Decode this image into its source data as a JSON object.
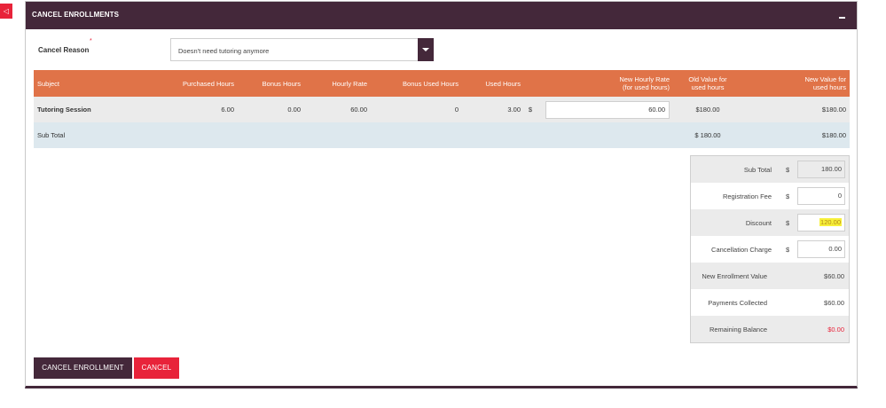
{
  "side_tab": {
    "icon": "◁"
  },
  "panel": {
    "title": "CANCEL ENROLLMENTS",
    "collapse_icon": "minus-icon"
  },
  "cancel_reason": {
    "label": "Cancel Reason",
    "required_mark": "*",
    "selected": "Doesn't need tutoring anymore"
  },
  "table": {
    "headers": {
      "subject": "Subject",
      "purchased_hours": "Purchased Hours",
      "bonus_hours": "Bonus Hours",
      "hourly_rate": "Hourly Rate",
      "bonus_used_hours": "Bonus Used Hours",
      "used_hours": "Used Hours",
      "new_hourly_rate_line1": "New Hourly Rate",
      "new_hourly_rate_line2": "(for used hours)",
      "old_value_line1": "Old Value for",
      "old_value_line2": "used hours",
      "new_value_line1": "New Value for",
      "new_value_line2": "used hours"
    },
    "row": {
      "subject": "Tutoring Session",
      "purchased_hours": "6.00",
      "bonus_hours": "0.00",
      "hourly_rate": "60.00",
      "bonus_used_hours": "0",
      "used_hours": "3.00",
      "currency": "$",
      "new_hourly_rate": "60.00",
      "old_value": "$180.00",
      "new_value": "$180.00"
    },
    "subtotal": {
      "label": "Sub Total",
      "old_value": "$  180.00",
      "new_value": "$180.00"
    }
  },
  "summary": {
    "sub_total": {
      "label": "Sub Total",
      "currency": "$",
      "value": "180.00"
    },
    "registration_fee": {
      "label": "Registration Fee",
      "currency": "$",
      "value": "0"
    },
    "discount": {
      "label": "Discount",
      "currency": "$",
      "value": "120.00"
    },
    "cancellation_charge": {
      "label": "Cancellation Charge",
      "currency": "$",
      "value": "0.00"
    },
    "new_enrollment_value": {
      "label": "New Enrollment Value",
      "value": "$60.00"
    },
    "payments_collected": {
      "label": "Payments Collected",
      "value": "$60.00"
    },
    "remaining_balance": {
      "label": "Remaining Balance",
      "value": "$0.00"
    }
  },
  "buttons": {
    "cancel_enrollment": "CANCEL ENROLLMENT",
    "cancel": "CANCEL"
  },
  "colors": {
    "header_bg": "#44283a",
    "table_header_bg": "#e07348",
    "accent_red": "#e8233a",
    "highlight": "#f7f03a"
  }
}
